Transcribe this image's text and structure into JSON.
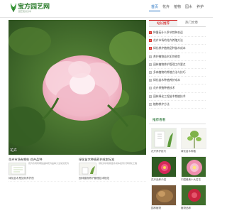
{
  "header": {
    "logo_text": "宝方园艺网",
    "logo_sub": "园艺知识分享",
    "nav": [
      "首页",
      "花卉",
      "植物",
      "园木",
      "养护"
    ]
  },
  "hero": {
    "caption": "花卉"
  },
  "sidebar": {
    "tabs": [
      "站长推荐",
      "热门文章"
    ],
    "articles": [
      {
        "rank": "1",
        "title": "种番茄什么季节栽种合适"
      },
      {
        "rank": "2",
        "title": "花卉市场的花卉养殖方法"
      },
      {
        "rank": "3",
        "title": "绿化养护植物品种苗木成本"
      },
      {
        "rank": "4",
        "title": "养护植物苗木如何修剪"
      },
      {
        "rank": "5",
        "title": "园林植物养护管理工作要点"
      },
      {
        "rank": "6",
        "title": "多肉植物的养殖方法与技巧"
      },
      {
        "rank": "7",
        "title": "绿化苗木种植养护成本"
      },
      {
        "rank": "8",
        "title": "花卉养殖种植技术"
      },
      {
        "rank": "9",
        "title": "园林绿化工程苗木栽植技术"
      },
      {
        "rank": "10",
        "title": "植物养护方法"
      }
    ]
  },
  "recommend": {
    "title": "推荐看看",
    "items": [
      {
        "caption": "花卉养护技巧"
      },
      {
        "caption": "绿化苗木种植"
      },
      {
        "caption": "花卉品种介绍"
      },
      {
        "caption": "中国最美十大名花"
      },
      {
        "caption": "园林植物"
      },
      {
        "caption": "植物品种"
      }
    ]
  },
  "bottom": {
    "left_card": {
      "title": "花卉市场有哪些 花卉品种",
      "excerpt": "花卉市场有哪些品种花卉品种大全常见花卉"
    },
    "right_card": {
      "title": "绿化苗木种植养护成本标准",
      "excerpt": "绿化养护植物苗木成本如何计算绿化工程"
    },
    "lines": [
      "绿化苗木是如何养护的",
      "园林植物养护管理技术规范"
    ]
  }
}
